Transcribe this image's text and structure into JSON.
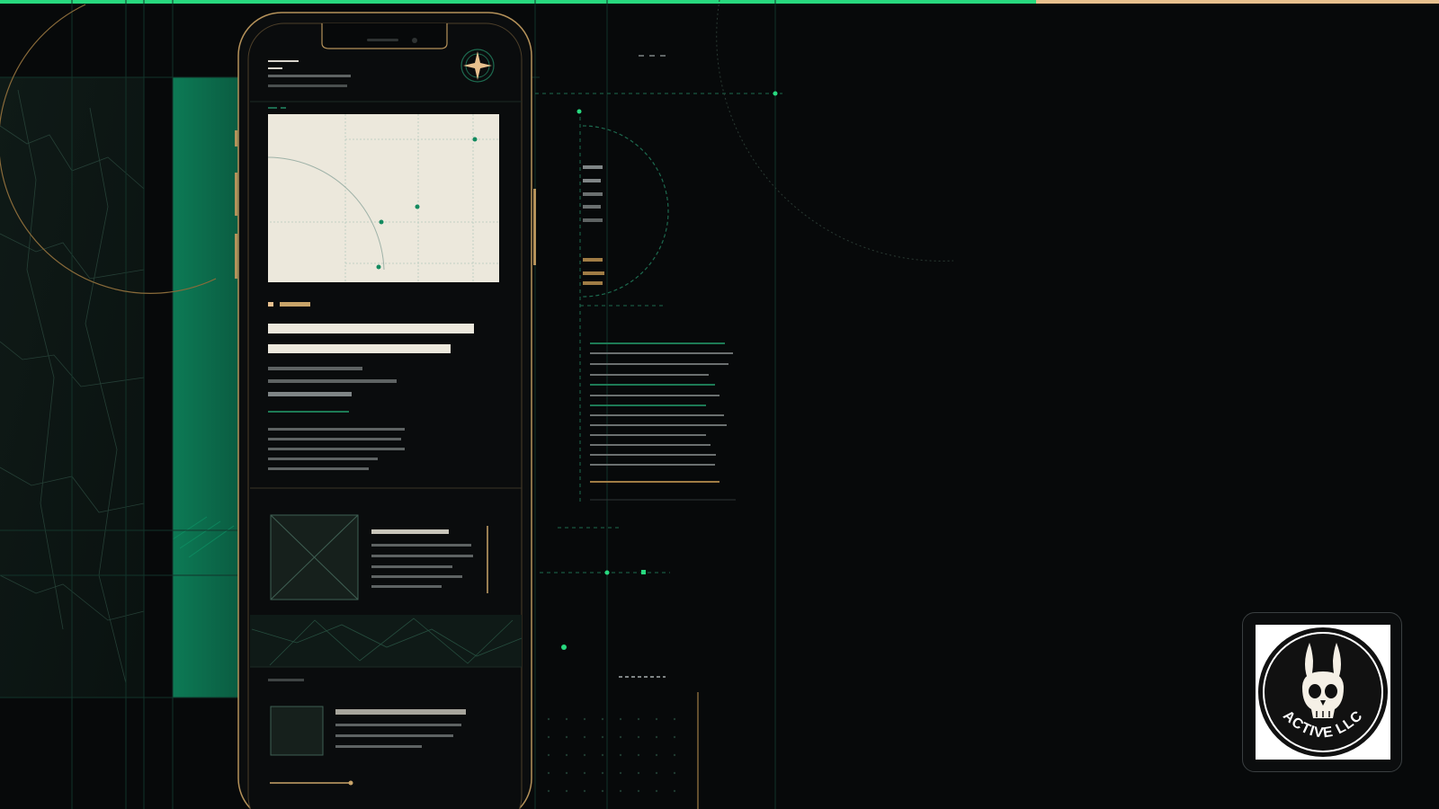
{
  "progress": {
    "fraction": 0.72,
    "fill_color": "#28d97f",
    "track_color": "#e7c08e"
  },
  "colors": {
    "accent_green": "#0e6b4c",
    "accent_gold": "#c9a469",
    "card_paper": "#ece8dc"
  },
  "phone": {
    "menu_icon": "hamburger-menu-icon",
    "compass_icon": "compass-star-icon"
  },
  "brand": {
    "logo_text": "ACTIVE LLC",
    "logo_icon": "rabbit-skull-icon"
  }
}
